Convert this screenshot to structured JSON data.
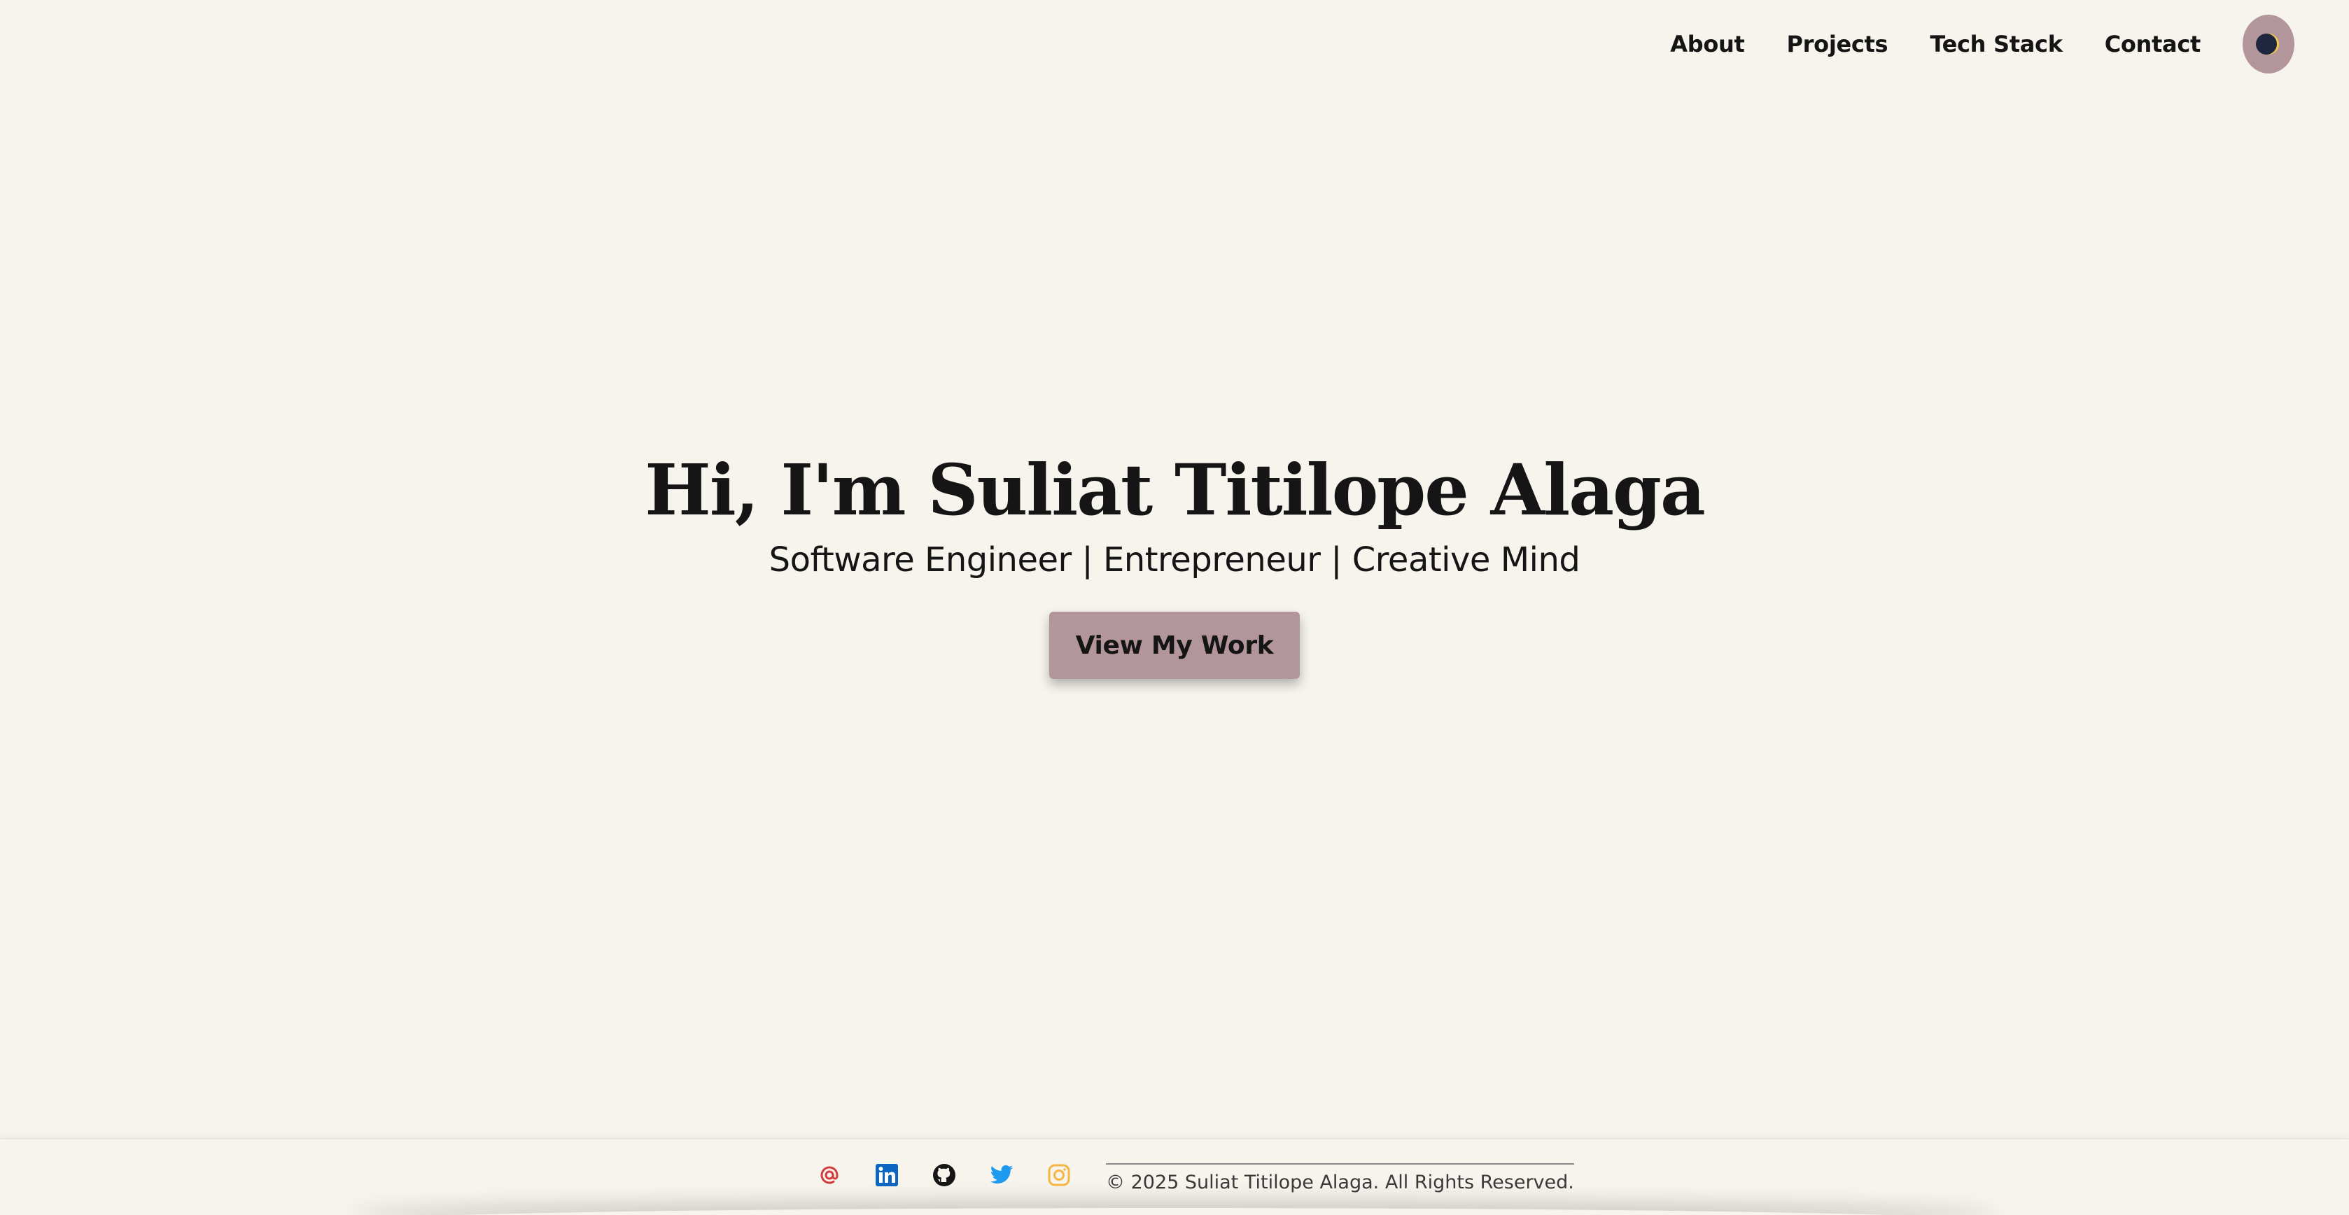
{
  "nav": {
    "items": [
      {
        "label": "About"
      },
      {
        "label": "Projects"
      },
      {
        "label": "Tech Stack"
      },
      {
        "label": "Contact"
      }
    ],
    "theme_toggle_icon": "moon-icon"
  },
  "hero": {
    "title": "Hi, I'm Suliat Titilope Alaga",
    "subtitle": "Software Engineer | Entrepreneur | Creative Mind",
    "cta_label": "View My Work"
  },
  "footer": {
    "social_icons": [
      "email-icon",
      "linkedin-icon",
      "github-icon",
      "twitter-icon",
      "instagram-icon"
    ],
    "copyright": "© 2025 Suliat Titilope Alaga. All Rights Reserved."
  },
  "colors": {
    "background": "#f7f4ee",
    "accent": "#b3969c",
    "text": "#151515",
    "email": "#d13b3b",
    "linkedin": "#0a66c2",
    "github": "#151515",
    "twitter": "#1d9bf0",
    "instagram": "#f5b642"
  }
}
